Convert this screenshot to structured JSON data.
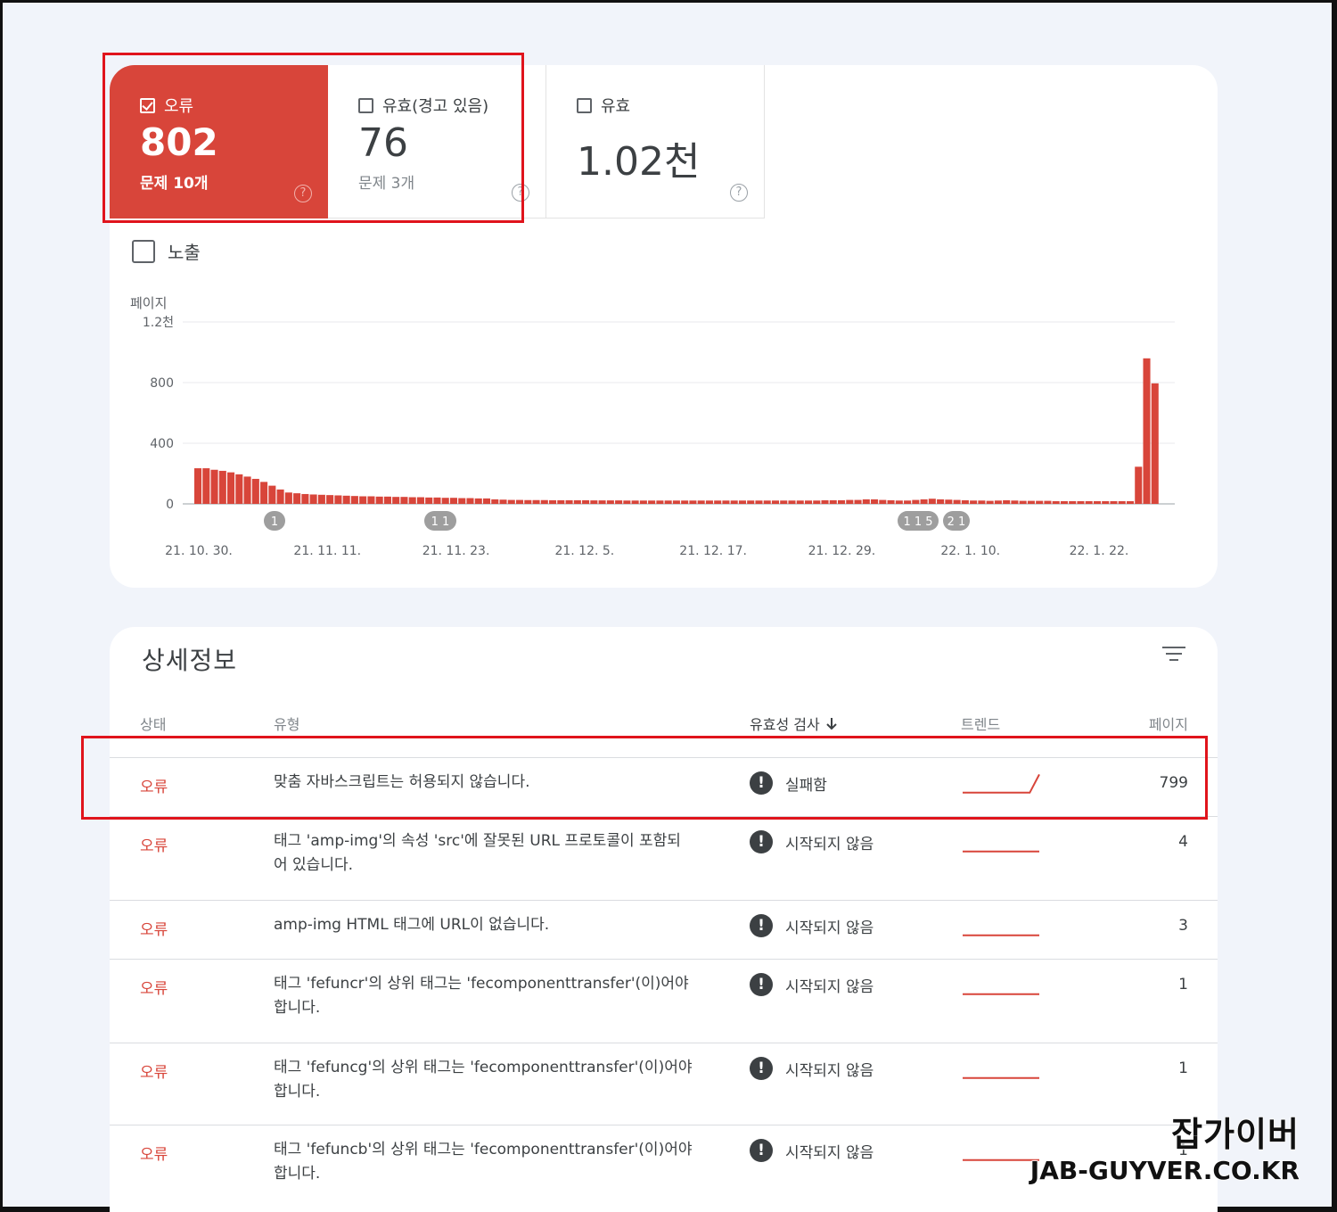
{
  "tiles": {
    "error": {
      "label": "오류",
      "count": "802",
      "sub": "문제 10개",
      "help": "?"
    },
    "warn": {
      "label": "유효(경고 있음)",
      "count": "76",
      "sub": "문제 3개",
      "help": "?"
    },
    "valid": {
      "label": "유효",
      "count": "1.02천",
      "help": "?"
    }
  },
  "exposure_label": "노출",
  "colors": {
    "error": "#d8453a",
    "highlight": "#e0141c",
    "annotation": "#9e9e9e"
  },
  "chart_data": {
    "type": "bar",
    "ylabel": "페이지",
    "y_ticks": [
      "0",
      "400",
      "800",
      "1.2천"
    ],
    "ylim": [
      0,
      1200
    ],
    "x_tick_labels": [
      "21. 10. 30.",
      "21. 11. 11.",
      "21. 11. 23.",
      "21. 12. 5.",
      "21. 12. 17.",
      "21. 12. 29.",
      "22. 1. 10.",
      "22. 1. 22."
    ],
    "values": [
      235,
      235,
      225,
      218,
      208,
      195,
      180,
      165,
      145,
      120,
      95,
      75,
      70,
      65,
      62,
      60,
      58,
      56,
      54,
      52,
      50,
      50,
      48,
      48,
      46,
      46,
      44,
      44,
      42,
      42,
      40,
      40,
      38,
      38,
      36,
      36,
      30,
      28,
      26,
      26,
      25,
      25,
      25,
      24,
      24,
      24,
      24,
      24,
      23,
      23,
      23,
      23,
      22,
      22,
      22,
      22,
      22,
      22,
      22,
      22,
      22,
      22,
      22,
      22,
      22,
      22,
      22,
      22,
      22,
      22,
      22,
      22,
      22,
      22,
      22,
      22,
      24,
      24,
      24,
      26,
      26,
      30,
      30,
      26,
      24,
      22,
      22,
      26,
      30,
      34,
      30,
      28,
      26,
      24,
      22,
      22,
      20,
      22,
      24,
      22,
      20,
      20,
      20,
      20,
      18,
      18,
      18,
      18,
      18,
      18,
      18,
      18,
      18,
      18,
      245,
      960,
      795
    ],
    "annotations": [
      "1",
      "1 1",
      "1 1 5",
      "2 1"
    ],
    "grid": true
  },
  "detail": {
    "title": "상세정보",
    "columns": {
      "status": "상태",
      "type": "유형",
      "validation": "유효성 검사",
      "trend": "트렌드",
      "pages": "페이지"
    },
    "rows": [
      {
        "status": "오류",
        "type": "맞춤 자바스크립트는 허용되지 않습니다.",
        "validation": "실패함",
        "pages": "799",
        "trend": [
          0.05,
          0.05,
          0.05,
          0.05,
          0.05,
          0.05,
          0.05,
          0.05,
          0.9
        ]
      },
      {
        "status": "오류",
        "type": "태그 'amp-img'의 속성 'src'에 잘못된 URL 프로토콜이 포함되어 있습니다.",
        "validation": "시작되지 않음",
        "pages": "4",
        "trend": [
          0.05,
          0.05,
          0.05,
          0.05,
          0.05,
          0.05,
          0.05,
          0.05,
          0.05
        ]
      },
      {
        "status": "오류",
        "type": "amp-img HTML 태그에 URL이 없습니다.",
        "validation": "시작되지 않음",
        "pages": "3",
        "trend": [
          0.05,
          0.05,
          0.05,
          0.05,
          0.05,
          0.05,
          0.05,
          0.05,
          0.05
        ]
      },
      {
        "status": "오류",
        "type": "태그 'fefuncr'의 상위 태그는 'fecomponenttransfer'(이)어야 합니다.",
        "validation": "시작되지 않음",
        "pages": "1",
        "trend": [
          0.05,
          0.05,
          0.05,
          0.05,
          0.05,
          0.05,
          0.05,
          0.05,
          0.05
        ]
      },
      {
        "status": "오류",
        "type": "태그 'fefuncg'의 상위 태그는 'fecomponenttransfer'(이)어야 합니다.",
        "validation": "시작되지 않음",
        "pages": "1",
        "trend": [
          0.05,
          0.05,
          0.05,
          0.05,
          0.05,
          0.05,
          0.05,
          0.05,
          0.05
        ]
      },
      {
        "status": "오류",
        "type": "태그 'fefuncb'의 상위 태그는 'fecomponenttransfer'(이)어야 합니다.",
        "validation": "시작되지 않음",
        "pages": "1",
        "trend": [
          0.05,
          0.05,
          0.05,
          0.05,
          0.05,
          0.05,
          0.05,
          0.05,
          0.05
        ]
      }
    ]
  },
  "watermark": {
    "main": "잡가이버",
    "sub": "JAB-GUYVER.CO.KR"
  }
}
